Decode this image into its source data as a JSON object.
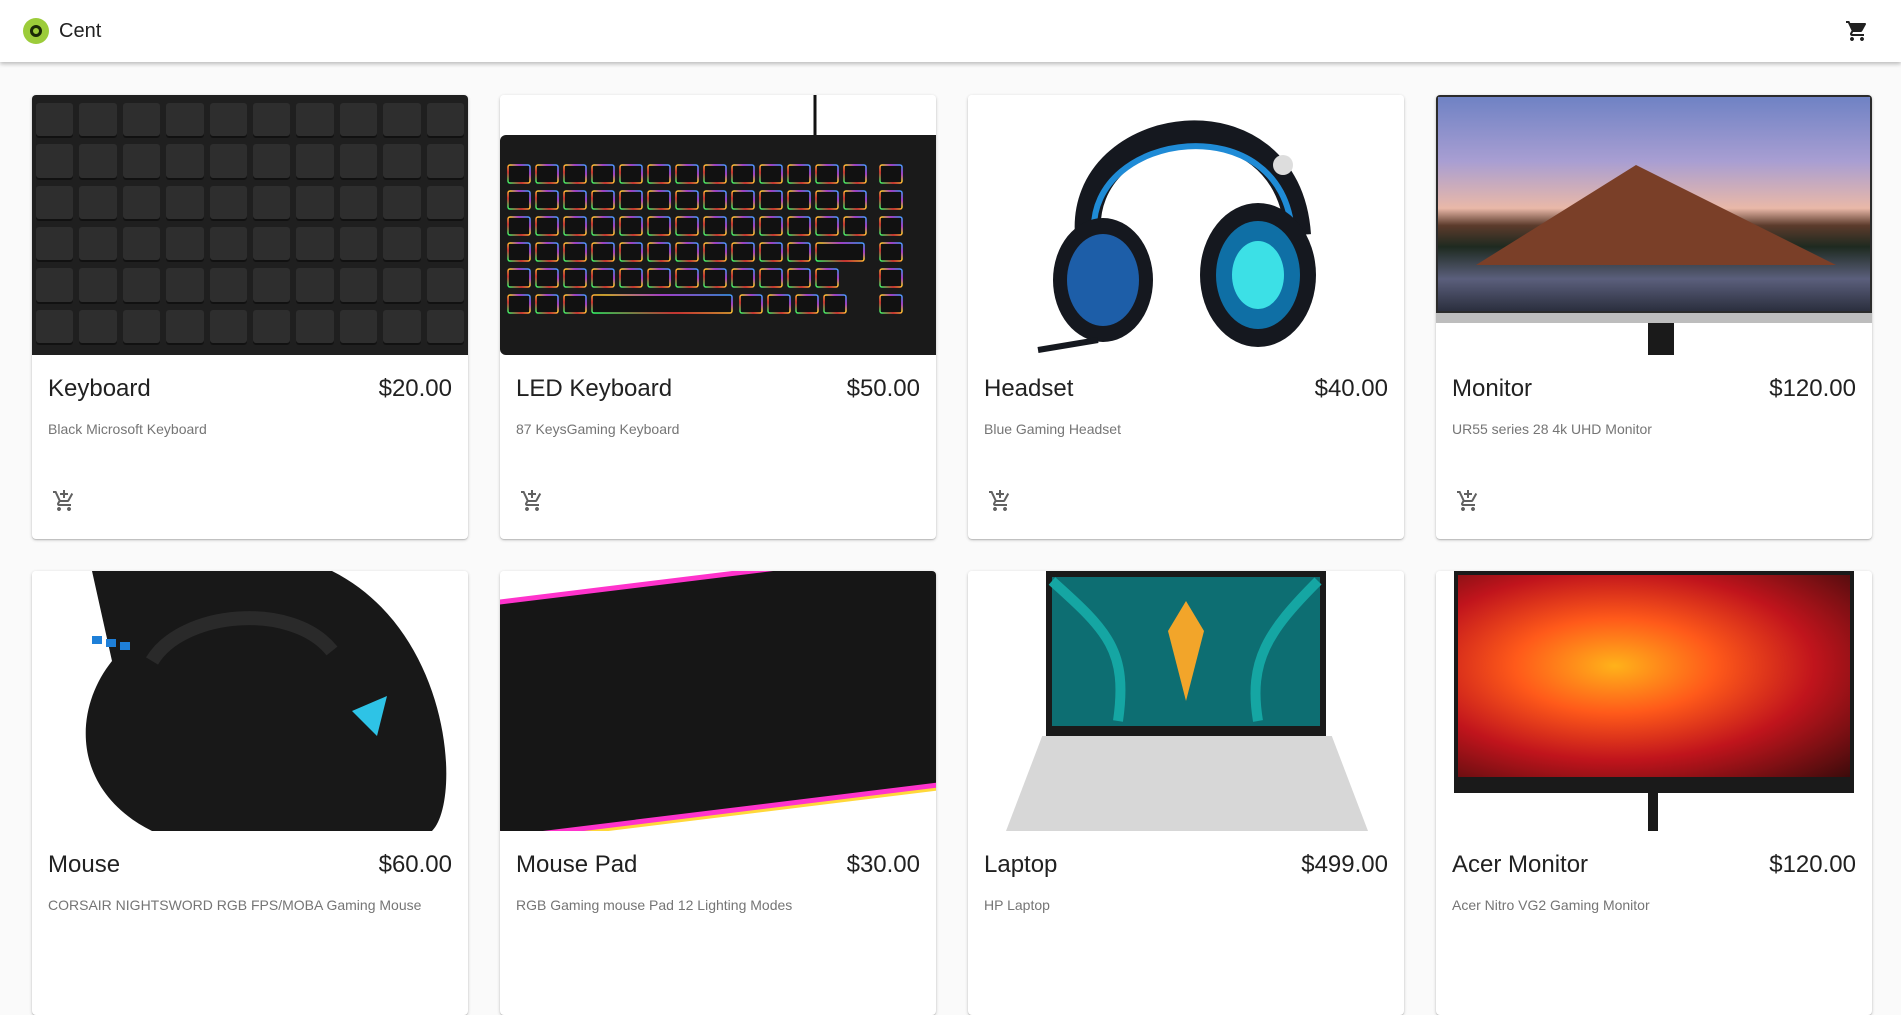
{
  "app": {
    "title": "Cent"
  },
  "header": {
    "logo_icon": "circle-logo-icon",
    "cart_icon": "shopping-cart-icon"
  },
  "colors": {
    "brand": "#9ccc3a",
    "accent": "#212121"
  },
  "products": [
    {
      "name": "Keyboard",
      "price": "$20.00",
      "description": "Black Microsoft Keyboard"
    },
    {
      "name": "LED Keyboard",
      "price": "$50.00",
      "description": "87 KeysGaming Keyboard"
    },
    {
      "name": "Headset",
      "price": "$40.00",
      "description": "Blue Gaming Headset"
    },
    {
      "name": "Monitor",
      "price": "$120.00",
      "description": "UR55 series 28 4k UHD Monitor"
    },
    {
      "name": "Mouse",
      "price": "$60.00",
      "description": "CORSAIR NIGHTSWORD RGB FPS/MOBA Gaming Mouse"
    },
    {
      "name": "Mouse Pad",
      "price": "$30.00",
      "description": "RGB Gaming mouse Pad 12 Lighting Modes"
    },
    {
      "name": "Laptop",
      "price": "$499.00",
      "description": "HP Laptop"
    },
    {
      "name": "Acer Monitor",
      "price": "$120.00",
      "description": "Acer Nitro VG2 Gaming Monitor"
    }
  ]
}
